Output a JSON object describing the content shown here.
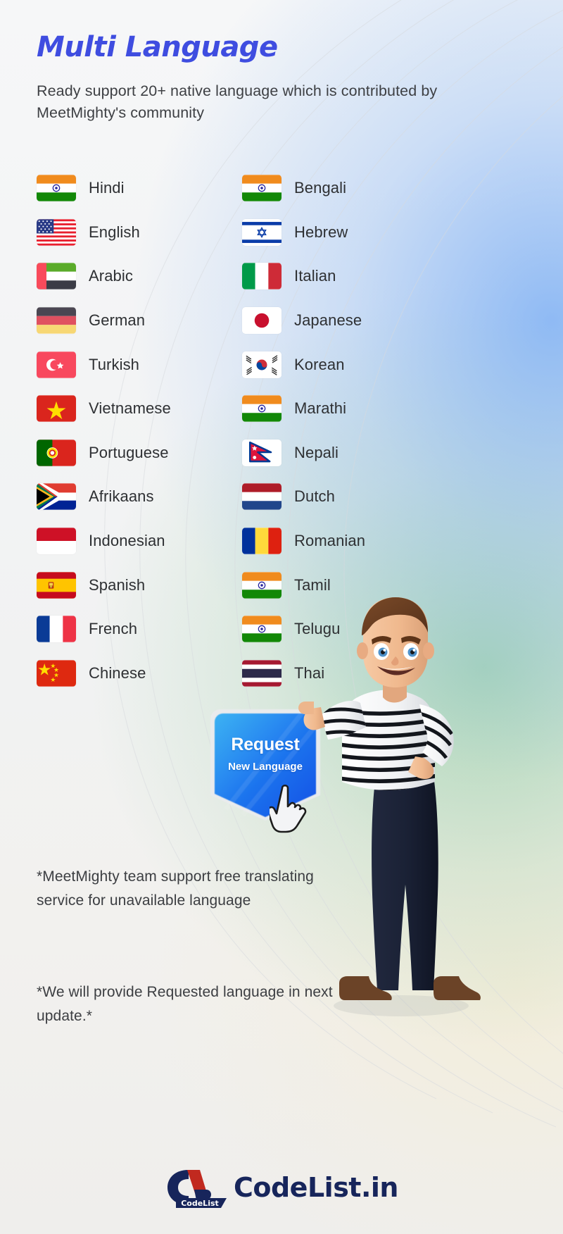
{
  "header": {
    "title": "Multi Language",
    "subtitle": "Ready support 20+ native language which is contributed by MeetMighty's community"
  },
  "colors": {
    "title_accent": "#3f4de0",
    "badge_blue_light": "#17a0ef",
    "badge_blue_dark": "#1756e8",
    "logo_navy": "#17255b",
    "logo_red": "#c1291f",
    "body_text": "#3c3e42"
  },
  "languages": [
    {
      "name": "Hindi",
      "flag": "india-flag-icon"
    },
    {
      "name": "Bengali",
      "flag": "india-flag-icon"
    },
    {
      "name": "English",
      "flag": "usa-flag-icon"
    },
    {
      "name": "Hebrew",
      "flag": "israel-flag-icon"
    },
    {
      "name": "Arabic",
      "flag": "uae-flag-icon"
    },
    {
      "name": "Italian",
      "flag": "italy-flag-icon"
    },
    {
      "name": "German",
      "flag": "germany-flag-icon"
    },
    {
      "name": "Japanese",
      "flag": "japan-flag-icon"
    },
    {
      "name": "Turkish",
      "flag": "turkey-flag-icon"
    },
    {
      "name": "Korean",
      "flag": "south-korea-flag-icon"
    },
    {
      "name": "Vietnamese",
      "flag": "vietnam-flag-icon"
    },
    {
      "name": "Marathi",
      "flag": "india-flag-icon"
    },
    {
      "name": "Portuguese",
      "flag": "portugal-flag-icon"
    },
    {
      "name": "Nepali",
      "flag": "nepal-flag-icon"
    },
    {
      "name": "Afrikaans",
      "flag": "south-africa-flag-icon"
    },
    {
      "name": "Dutch",
      "flag": "netherlands-flag-icon"
    },
    {
      "name": "Indonesian",
      "flag": "indonesia-flag-icon"
    },
    {
      "name": "Romanian",
      "flag": "romania-flag-icon"
    },
    {
      "name": "Spanish",
      "flag": "spain-flag-icon"
    },
    {
      "name": "Tamil",
      "flag": "india-flag-icon"
    },
    {
      "name": "French",
      "flag": "france-flag-icon"
    },
    {
      "name": "Telugu",
      "flag": "india-flag-icon"
    },
    {
      "name": "Chinese",
      "flag": "china-flag-icon"
    },
    {
      "name": "Thai",
      "flag": "thailand-flag-icon"
    }
  ],
  "badge": {
    "main_label": "Request",
    "sub_label": "New Language",
    "cursor": "pointing-hand-cursor-icon"
  },
  "notes": {
    "note1": "*MeetMighty team support free translating service for unavailable language",
    "note2": "*We will provide Requested language in next update.*"
  },
  "footer": {
    "logo_mark_text": "CodeList",
    "logo_wordmark": "CodeList.in"
  },
  "illustration": {
    "character": "3d-cartoon-man-character"
  }
}
